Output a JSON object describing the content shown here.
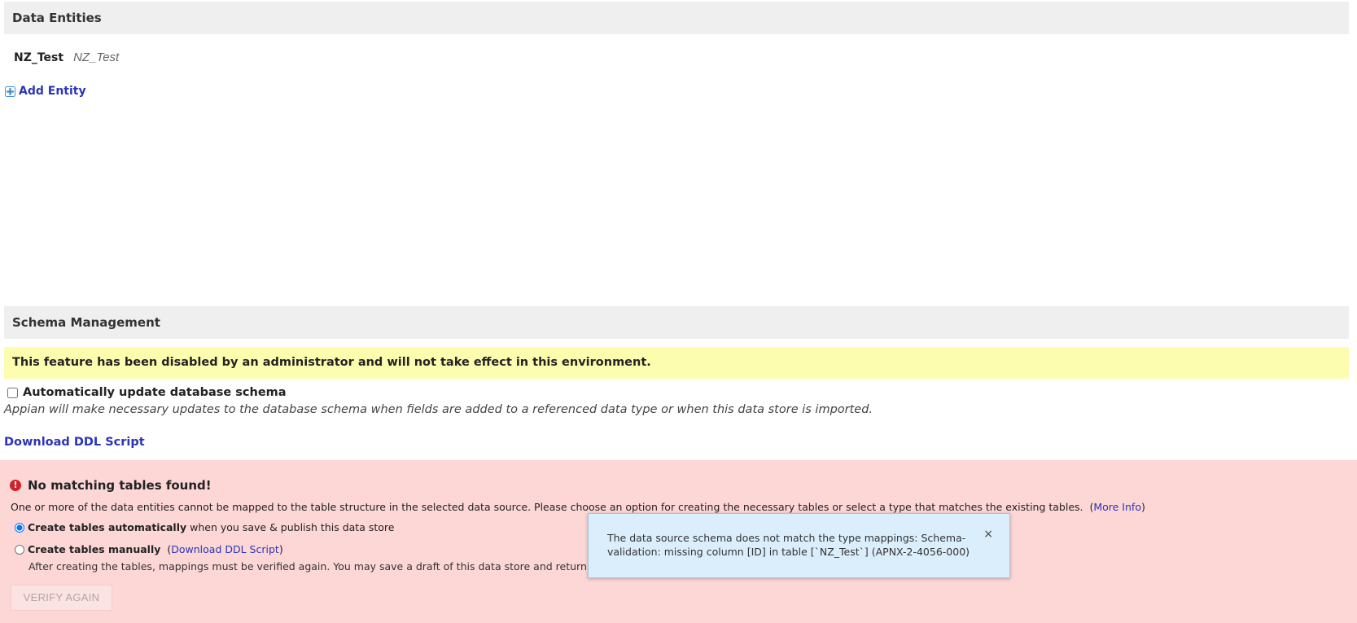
{
  "data_entities": {
    "title": "Data Entities",
    "entity": {
      "name": "NZ_Test",
      "description": "NZ_Test"
    },
    "add_entity_label": "Add Entity"
  },
  "schema_management": {
    "title": "Schema Management",
    "disabled_notice": "This feature has been disabled by an administrator and will not take effect in this environment.",
    "auto_update_label": "Automatically update database schema",
    "auto_update_checked": false,
    "auto_update_description": "Appian will make necessary updates to the database schema when fields are added to a referenced data type or when this data store is imported.",
    "download_ddl_label": "Download DDL Script"
  },
  "error_panel": {
    "title": "No matching tables found!",
    "message": "One or more of the data entities cannot be mapped to the table structure in the selected data source. Please choose an option for creating the necessary tables or select a type that matches the existing tables.",
    "more_info_label": "More Info",
    "option_auto_bold": "Create tables automatically",
    "option_auto_rest": "when you save & publish this data store",
    "option_auto_selected": true,
    "option_manual_bold": "Create tables manually",
    "option_manual_link": "Download DDL Script",
    "manual_note": "After creating the tables, mappings must be verified again. You may save a draft of this data store and return to this page at",
    "verify_button": "VERIFY AGAIN"
  },
  "tooltip": {
    "text": "The data source schema does not match the type mappings: Schema-validation: missing column [ID] in table [`NZ_Test`] (APNX-2-4056-000)",
    "close_glyph": "×"
  },
  "colors": {
    "link": "#2b35b8",
    "warning_bg": "#fdfdb0",
    "error_bg": "#fdd6d6",
    "error_icon": "#d3212a",
    "tooltip_bg": "#dbeefc"
  },
  "icons": {
    "add_entity": "plus-circle-icon",
    "error": "exclamation-circle-icon",
    "close": "close-icon"
  }
}
